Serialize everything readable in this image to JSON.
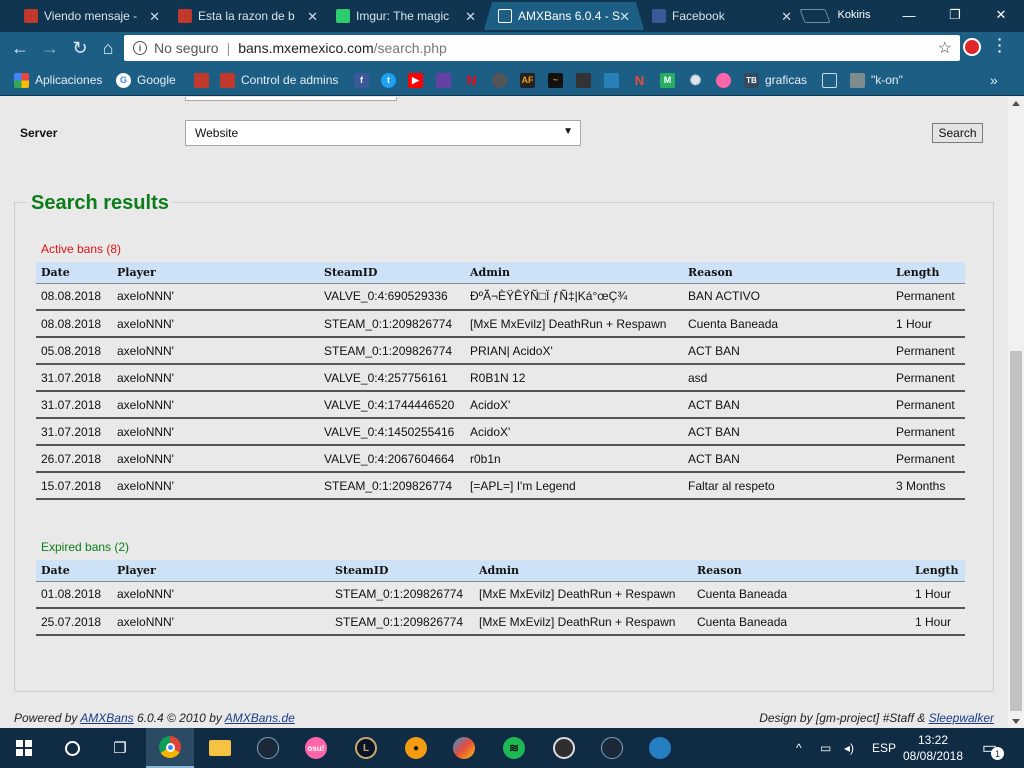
{
  "browser": {
    "tabs": [
      {
        "title": "Viendo mensaje - ",
        "favicon_color": "#c0392b",
        "active": false
      },
      {
        "title": "Esta la razon de b",
        "favicon_color": "#c0392b",
        "active": false
      },
      {
        "title": "Imgur: The magic ",
        "favicon_color": "#2ecc71",
        "active": false
      },
      {
        "title": "AMXBans 6.0.4 - S",
        "favicon_color": "#ffffff",
        "active": true
      },
      {
        "title": "Facebook",
        "favicon_color": "#3b5998",
        "active": false
      }
    ],
    "profile_name": "Kokiris",
    "window_controls": {
      "minimize": "—",
      "restore": "❐",
      "close": "✕"
    },
    "address": {
      "security_label": "No seguro",
      "host": "bans.mxemexico.com",
      "path": "/search.php"
    },
    "bookmarks": [
      {
        "label": "Aplicaciones",
        "icon": "apps-grid-icon",
        "color": "#e8453c"
      },
      {
        "label": "Google",
        "icon": "google-g-icon",
        "color": "#ffffff"
      },
      {
        "label": "",
        "icon": "red-mark-icon",
        "color": "#c0392b"
      },
      {
        "label": "Control de admins",
        "icon": "red-mark-icon",
        "color": "#c0392b"
      },
      {
        "label": "",
        "icon": "facebook-icon",
        "color": "#3b5998"
      },
      {
        "label": "",
        "icon": "twitter-icon",
        "color": "#1da1f2"
      },
      {
        "label": "",
        "icon": "youtube-icon",
        "color": "#ff0000"
      },
      {
        "label": "",
        "icon": "twitch-icon",
        "color": "#6441a5"
      },
      {
        "label": "",
        "icon": "netflix-icon",
        "color": "#e50914"
      },
      {
        "label": "",
        "icon": "steam-icon",
        "color": "#555555"
      },
      {
        "label": "",
        "icon": "af-icon",
        "color": "#222222"
      },
      {
        "label": "",
        "icon": "wave-icon",
        "color": "#e67e22"
      },
      {
        "label": "",
        "icon": "dark-icon",
        "color": "#333333"
      },
      {
        "label": "",
        "icon": "blue-square-icon",
        "color": "#2980b9"
      },
      {
        "label": "",
        "icon": "red-n-icon",
        "color": "#c0392b"
      },
      {
        "label": "",
        "icon": "m-icon",
        "color": "#27ae60"
      },
      {
        "label": "",
        "icon": "gear-icon",
        "color": "#bdc3c7"
      },
      {
        "label": "",
        "icon": "osu-icon",
        "color": "#ff66aa"
      },
      {
        "label": "graficas",
        "icon": "tb-icon",
        "color": "#34495e"
      },
      {
        "label": "",
        "icon": "page-icon",
        "color": "#ecf0f1"
      },
      {
        "label": "\"k-on\"",
        "icon": "folder-icon",
        "color": "#7f8c8d"
      }
    ],
    "overflow_label": "»"
  },
  "page": {
    "server": {
      "label": "Server",
      "selected": "Website",
      "search_button": "Search"
    },
    "results_title": "Search results",
    "active": {
      "title": "Active bans (8)",
      "headers": [
        "Date",
        "Player",
        "SteamID",
        "Admin",
        "Reason",
        "Length"
      ],
      "rows": [
        [
          "08.08.2018",
          "axeloNNN'",
          "VALVE_0:4:690529336",
          "ÐºÃ¬ÈŸÊŸÑ□Ï ƒÑ‡|Ká°œÇ¾",
          "BAN ACTIVO",
          "Permanent"
        ],
        [
          "08.08.2018",
          "axeloNNN'",
          "STEAM_0:1:209826774",
          "[MxE MxEvilz] DeathRun + Respawn",
          "Cuenta Baneada",
          "1 Hour"
        ],
        [
          "05.08.2018",
          "axeloNNN'",
          "STEAM_0:1:209826774",
          "PRIAN| AcidoX'",
          "ACT BAN",
          "Permanent"
        ],
        [
          "31.07.2018",
          "axeloNNN'",
          "VALVE_0:4:257756161",
          "R0B1N 12",
          "asd",
          "Permanent"
        ],
        [
          "31.07.2018",
          "axeloNNN'",
          "VALVE_0:4:1744446520",
          "AcidoX'",
          "ACT BAN",
          "Permanent"
        ],
        [
          "31.07.2018",
          "axeloNNN'",
          "VALVE_0:4:1450255416",
          "AcidoX'",
          "ACT BAN",
          "Permanent"
        ],
        [
          "26.07.2018",
          "axeloNNN'",
          "VALVE_0:4:2067604664",
          "r0b1n",
          "ACT BAN",
          "Permanent"
        ],
        [
          "15.07.2018",
          "axeloNNN'",
          "STEAM_0:1:209826774",
          "[=APL=] I'm Legend",
          "Faltar al respeto",
          "3 Months"
        ]
      ]
    },
    "expired": {
      "title": "Expired bans (2)",
      "headers": [
        "Date",
        "Player",
        "SteamID",
        "Admin",
        "Reason",
        "Length"
      ],
      "rows": [
        [
          "01.08.2018",
          "axeloNNN'",
          "STEAM_0:1:209826774",
          "[MxE MxEvilz] DeathRun + Respawn",
          "Cuenta Baneada",
          "1 Hour"
        ],
        [
          "25.07.2018",
          "axeloNNN'",
          "STEAM_0:1:209826774",
          "[MxE MxEvilz] DeathRun + Respawn",
          "Cuenta Baneada",
          "1 Hour"
        ]
      ]
    },
    "footer": {
      "powered_prefix": "Powered by ",
      "amxbans_link": "AMXBans",
      "powered_middle": " 6.0.4 © 2010 by ",
      "amxbans_de_link": "AMXBans.de",
      "design_prefix": "Design by [gm-project] #Staff & ",
      "sleepwalker_link": "Sleepwalker"
    }
  },
  "taskbar": {
    "apps": [
      {
        "name": "windows-start-icon",
        "color": "#ffffff"
      },
      {
        "name": "cortana-icon",
        "color": "#ffffff"
      },
      {
        "name": "task-view-icon",
        "color": "#ffffff"
      },
      {
        "name": "chrome-icon",
        "color": "#4caf50"
      },
      {
        "name": "file-explorer-icon",
        "color": "#f5c242"
      },
      {
        "name": "steam-icon",
        "color": "#1b2838"
      },
      {
        "name": "osu-icon",
        "color": "#ff66aa"
      },
      {
        "name": "league-icon",
        "color": "#c8aa6e"
      },
      {
        "name": "csgo-icon",
        "color": "#f39c12"
      },
      {
        "name": "paint-icon",
        "color": "#3498db"
      },
      {
        "name": "spotify-icon",
        "color": "#1db954"
      },
      {
        "name": "obs-icon",
        "color": "#302e31"
      },
      {
        "name": "steam-icon",
        "color": "#1b2838"
      },
      {
        "name": "teamspeak-icon",
        "color": "#2580c3"
      }
    ],
    "language": "ESP",
    "time": "13:22",
    "date": "08/08/2018",
    "notification_count": "1"
  }
}
